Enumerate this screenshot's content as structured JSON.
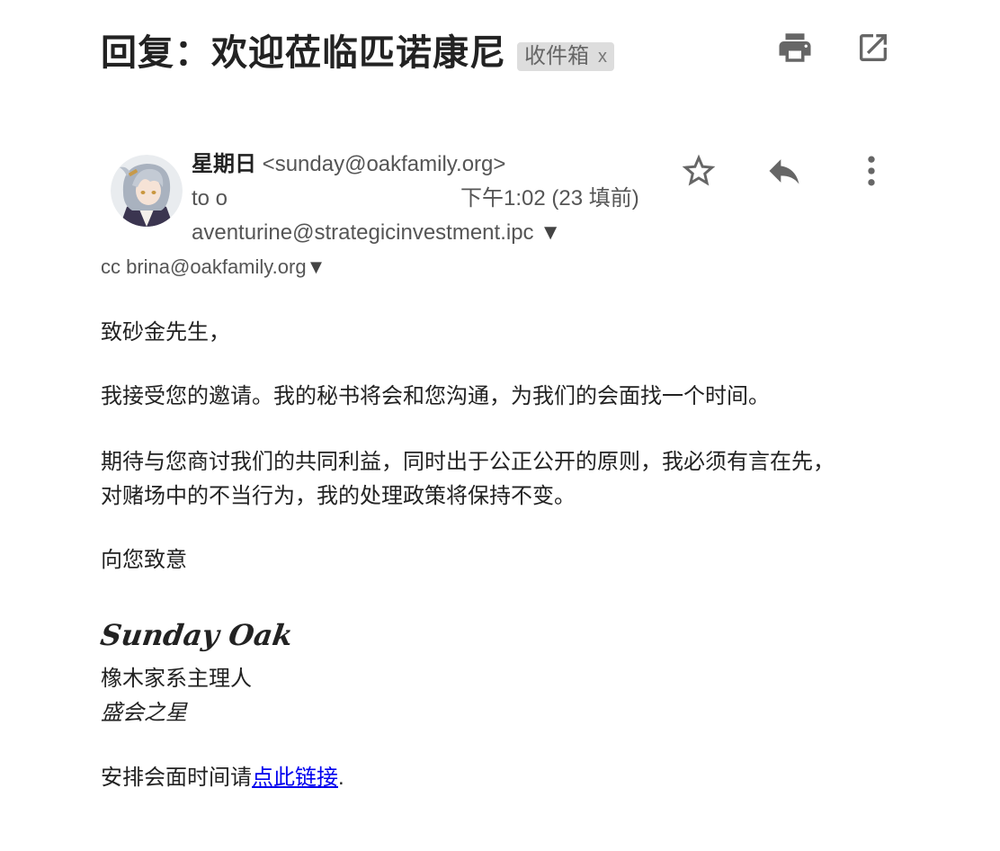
{
  "subject": {
    "title": "回复：欢迎莅临匹诺康尼",
    "label": "收件箱",
    "label_close": "x"
  },
  "toolbar": {
    "print_icon": "print-icon",
    "popout_icon": "open-in-new-window-icon"
  },
  "header": {
    "sender_name": "星期日",
    "sender_email": "<sunday@oakfamily.org>",
    "to_prefix": "to o",
    "time": "下午1:02 (23 填前)",
    "recipient": "aventurine@strategicinvestment.ipc",
    "recipient_arrow": "▼",
    "cc": "cc brina@oakfamily.org",
    "cc_arrow": "▼",
    "actions": {
      "star_icon": "star-icon",
      "reply_icon": "reply-icon",
      "more_icon": "more-vertical-icon"
    }
  },
  "body": {
    "greeting": "致砂金先生，",
    "para1": "我接受您的邀请。我的秘书将会和您沟通，为我们的会面找一个时间。",
    "para2_line1": "期待与您商讨我们的共同利益，同时出于公正公开的原则，我必须有言在先，",
    "para2_line2": "对赌场中的不当行为，我的处理政策将保持不变。",
    "closing": "向您致意"
  },
  "signature": {
    "script_name": "Sunday Oak",
    "role": "橡木家系主理人",
    "title": "盛会之星"
  },
  "schedule": {
    "prefix": "安排会面时间请",
    "link_text": "点此链接",
    "suffix": "."
  },
  "colors": {
    "link": "#0000ee",
    "chip_bg": "#dddddd",
    "icon": "#666666"
  }
}
